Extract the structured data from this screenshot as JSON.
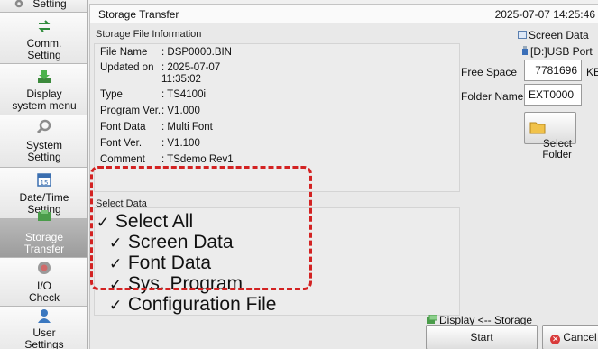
{
  "sidebar": {
    "items": [
      {
        "label": "Setting",
        "icon": "gear-icon"
      },
      {
        "label": "Comm.\nSetting",
        "icon": "comm-arrows-icon"
      },
      {
        "label": "Display\nsystem menu",
        "icon": "download-icon"
      },
      {
        "label": "System\nSetting",
        "icon": "wrench-icon"
      },
      {
        "label": "Date/Time\nSetting",
        "icon": "calendar-icon"
      },
      {
        "label": "Storage\nTransfer",
        "icon": "storage-transfer-icon",
        "active": true
      },
      {
        "label": "I/O\nCheck",
        "icon": "io-check-icon"
      },
      {
        "label": "User\nSettings",
        "icon": "user-icon"
      }
    ]
  },
  "header": {
    "title": "Storage Transfer",
    "datetime": "2025-07-07  14:25:46"
  },
  "file_info": {
    "section_label": "Storage File Information",
    "rows": [
      {
        "key": "File Name",
        "value": ": DSP0000.BIN"
      },
      {
        "key": "Updated on",
        "value": ": 2025-07-07\n  11:35:02"
      },
      {
        "key": "Type",
        "value": ": TS4100i"
      },
      {
        "key": "Program Ver.",
        "value": ": V1.000"
      },
      {
        "key": "Font Data",
        "value": ": Multi Font"
      },
      {
        "key": "Font Ver.",
        "value": ": V1.100"
      },
      {
        "key": "Comment",
        "value": ": TSdemo Rev1"
      }
    ]
  },
  "storage": {
    "data_type": "Screen Data",
    "port": "[D:]USB Port",
    "free_space_label": "Free Space",
    "free_space_value": "7781696",
    "free_space_unit": "KB",
    "folder_name_label": "Folder Name",
    "folder_name_value": "EXT0000",
    "select_folder_label": "Select\nFolder"
  },
  "select_data": {
    "section_label": "Select Data",
    "check_mark": "✓",
    "items": [
      {
        "label": "Select All",
        "checked": true
      },
      {
        "label": "Screen Data",
        "checked": true
      },
      {
        "label": "Font Data",
        "checked": true
      },
      {
        "label": "Sys. Program",
        "checked": true
      },
      {
        "label": "Configuration File",
        "checked": true
      }
    ]
  },
  "actions": {
    "direction_label": "Display <-- Storage",
    "start_label": "Start",
    "cancel_label": "Cancel"
  },
  "colors": {
    "highlight": "#d32222",
    "active_nav": "#a8a8a8",
    "cancel_icon": "#d93a3a"
  }
}
